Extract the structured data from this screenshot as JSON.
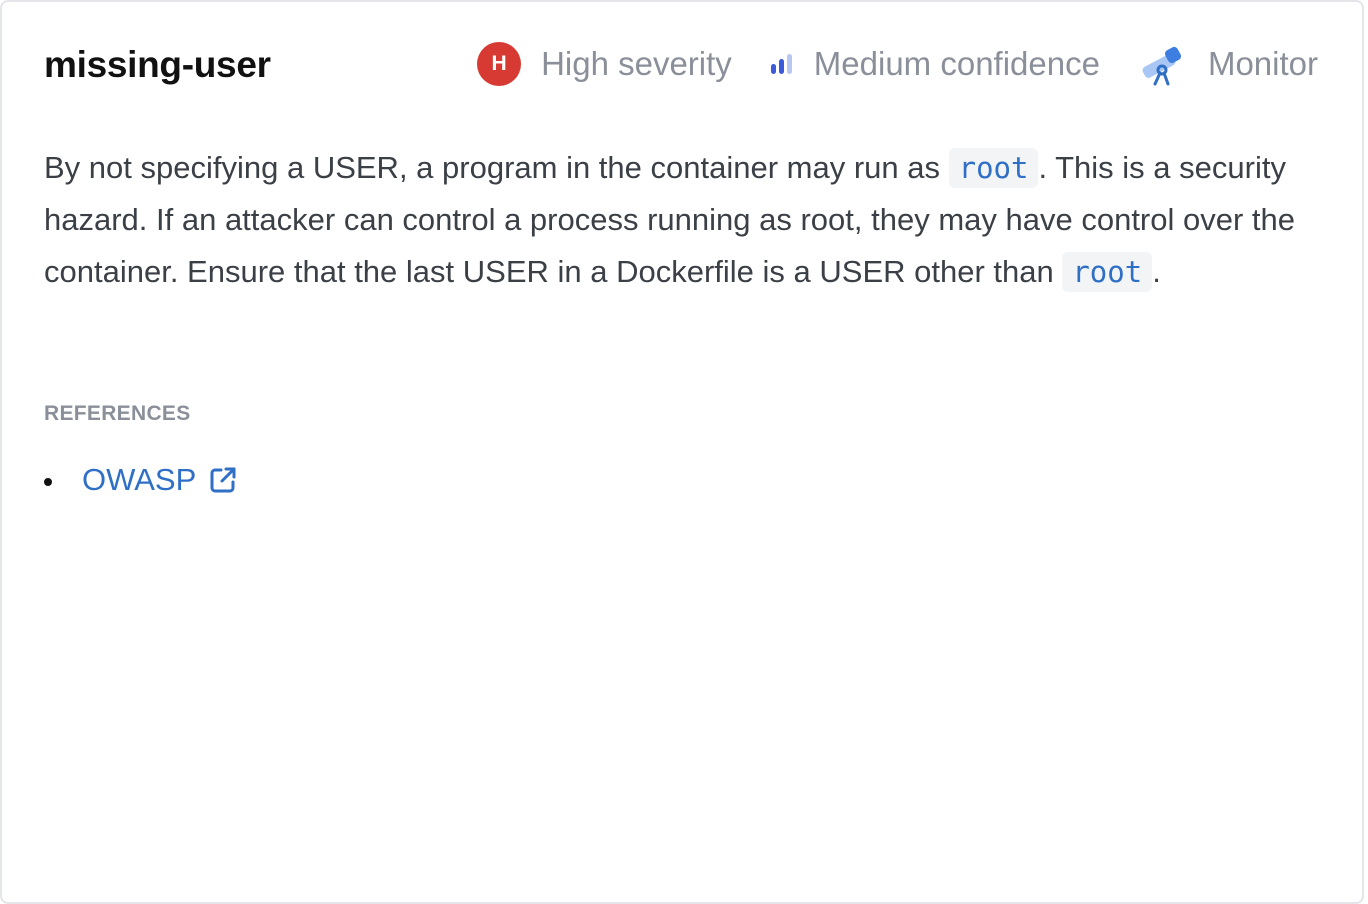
{
  "rule": {
    "name": "missing-user",
    "severity": {
      "badge_letter": "H",
      "label": "High severity",
      "color": "#d63a33"
    },
    "confidence": {
      "label": "Medium confidence",
      "icon": "signal-bars-icon",
      "level": 2,
      "max_level": 3
    },
    "mode": {
      "label": "Monitor",
      "icon": "telescope-icon"
    }
  },
  "description": {
    "part1": "By not specifying a USER, a program in the container may run as ",
    "code1": "root",
    "part2": ". This is a security hazard. If an attacker can control a process running as root, they may have control over the container. Ensure that the last USER in a Dockerfile is a USER other than ",
    "code2": "root",
    "part3": "."
  },
  "references": {
    "title": "REFERENCES",
    "items": [
      {
        "label": "OWASP",
        "icon": "external-link-icon"
      }
    ]
  },
  "colors": {
    "link": "#2f6fc6",
    "muted": "#8a8f99",
    "severity_high": "#d63a33"
  }
}
